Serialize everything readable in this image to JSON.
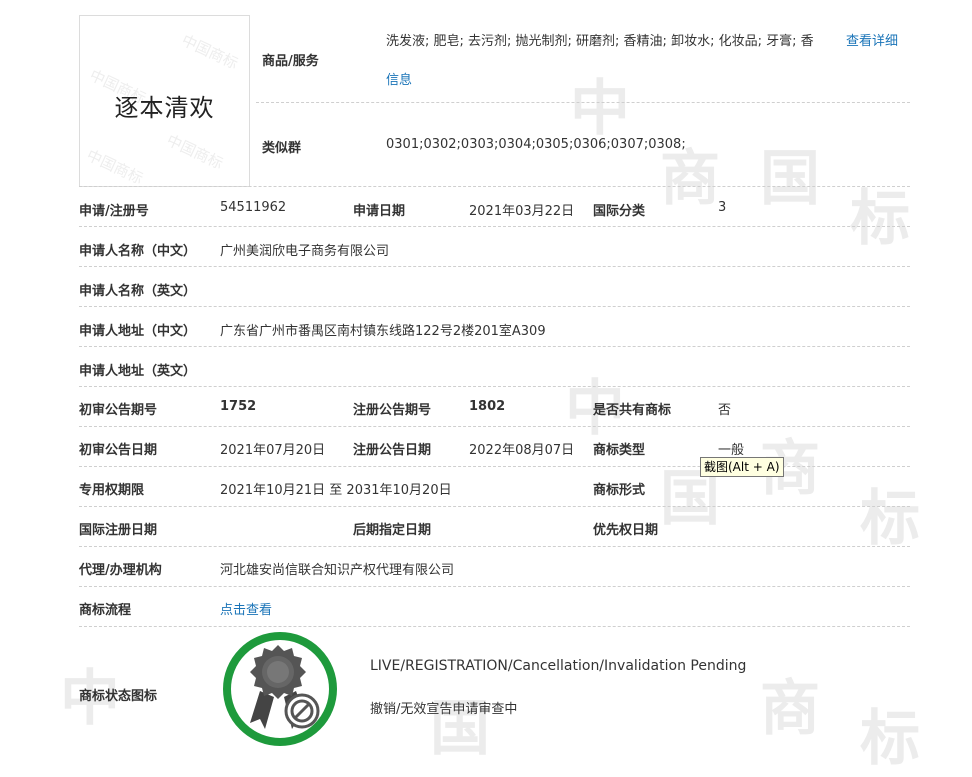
{
  "watermark": {
    "chars": [
      "中",
      "国",
      "商",
      "标"
    ]
  },
  "logo": {
    "text": "逐本清欢",
    "watermark": "中国商标"
  },
  "goods": {
    "label": "商品/服务",
    "value_line1": "洗发液; 肥皂; 去污剂; 抛光制剂; 研磨剂; 香精油; 卸妆水; 化妆品; 牙膏; 香",
    "detail_link_1": "查看详细",
    "detail_link_2": "信息"
  },
  "similar_group": {
    "label": "类似群",
    "value": "0301;0302;0303;0304;0305;0306;0307;0308;"
  },
  "rows": {
    "reg_no": {
      "label": "申请/注册号",
      "value": "54511962"
    },
    "apply_date": {
      "label": "申请日期",
      "value": "2021年03月22日"
    },
    "intl_class": {
      "label": "国际分类",
      "value": "3"
    },
    "applicant_cn": {
      "label": "申请人名称（中文）",
      "value": "广州美润欣电子商务有限公司"
    },
    "applicant_en": {
      "label": "申请人名称（英文）",
      "value": ""
    },
    "address_cn": {
      "label": "申请人地址（中文）",
      "value": "广东省广州市番禺区南村镇东线路122号2楼201室A309"
    },
    "address_en": {
      "label": "申请人地址（英文）",
      "value": ""
    },
    "prelim_issue": {
      "label": "初审公告期号",
      "value": "1752"
    },
    "reg_issue": {
      "label": "注册公告期号",
      "value": "1802"
    },
    "shared": {
      "label": "是否共有商标",
      "value": "否"
    },
    "prelim_date": {
      "label": "初审公告日期",
      "value": "2021年07月20日"
    },
    "reg_date": {
      "label": "注册公告日期",
      "value": "2022年08月07日"
    },
    "mark_type": {
      "label": "商标类型",
      "value": "一般"
    },
    "exclusive_period": {
      "label": "专用权期限",
      "value": "2021年10月21日 至 2031年10月20日"
    },
    "mark_form": {
      "label": "商标形式",
      "value": ""
    },
    "intl_reg_date": {
      "label": "国际注册日期",
      "value": ""
    },
    "later_date": {
      "label": "后期指定日期",
      "value": ""
    },
    "priority_date": {
      "label": "优先权日期",
      "value": ""
    },
    "agent": {
      "label": "代理/办理机构",
      "value": "河北雄安尚信联合知识产权代理有限公司"
    },
    "process": {
      "label": "商标流程",
      "link": "点击查看"
    },
    "status": {
      "label": "商标状态图标",
      "text_en": "LIVE/REGISTRATION/Cancellation/Invalidation Pending",
      "text_cn": "撤销/无效宣告申请审查中"
    }
  },
  "tooltip": {
    "text": "截图(Alt + A)"
  },
  "colors": {
    "link": "#1a74b8",
    "status_ring": "#1e9a3c",
    "dash": "#cfcfcf"
  }
}
